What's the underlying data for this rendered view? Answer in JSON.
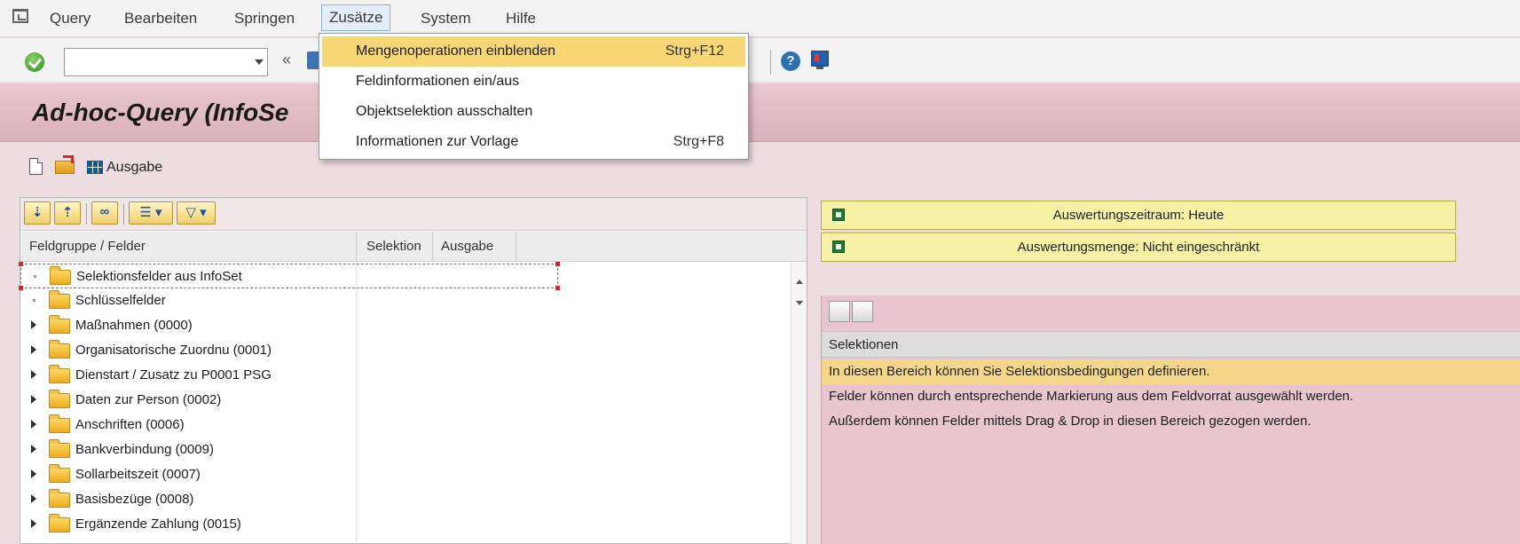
{
  "menubar": {
    "items": [
      {
        "label": "Query",
        "underline_first": true
      },
      {
        "label": "Bearbeiten",
        "underline_first": true
      },
      {
        "label": "Springen",
        "underline_first": true
      },
      {
        "label": "Zusätze",
        "underline_first": true,
        "active": true
      },
      {
        "label": "System",
        "underline_first": true
      },
      {
        "label": "Hilfe",
        "underline_first": true
      }
    ]
  },
  "dropdown": {
    "items": [
      {
        "label": "Mengenoperationen einblenden",
        "shortcut": "Strg+F12",
        "highlighted": true
      },
      {
        "label": "Feldinformationen ein/aus",
        "shortcut": ""
      },
      {
        "label": "Objektselektion ausschalten",
        "shortcut": ""
      },
      {
        "label": "Informationen zur Vorlage",
        "shortcut": "Strg+F8"
      }
    ]
  },
  "toolbar": {
    "command_value": ""
  },
  "page": {
    "title": "Ad-hoc-Query (InfoSe"
  },
  "apptoolbar": {
    "ausgabe_label": "Ausgabe"
  },
  "tree": {
    "columns": [
      "Feldgruppe / Felder",
      "Selektion",
      "Ausgabe"
    ],
    "rows": [
      {
        "label": "Selektionsfelder aus InfoSet",
        "expandable": false,
        "focused": true
      },
      {
        "label": "Schlüsselfelder",
        "expandable": false
      },
      {
        "label": "Maßnahmen (0000)",
        "expandable": true
      },
      {
        "label": "Organisatorische Zuordnu (0001)",
        "expandable": true
      },
      {
        "label": "Dienstart / Zusatz zu P0001 PSG",
        "expandable": true
      },
      {
        "label": "Daten zur Person (0002)",
        "expandable": true
      },
      {
        "label": "Anschriften (0006)",
        "expandable": true
      },
      {
        "label": "Bankverbindung (0009)",
        "expandable": true
      },
      {
        "label": "Sollarbeitszeit (0007)",
        "expandable": true
      },
      {
        "label": "Basisbezüge (0008)",
        "expandable": true
      },
      {
        "label": "Ergänzende Zahlung (0015)",
        "expandable": true
      }
    ]
  },
  "right": {
    "buttons": [
      "Auswertungszeitraum: Heute",
      "Auswertungsmenge: Nicht eingeschränkt"
    ],
    "selection": {
      "header": "Selektionen",
      "lines": [
        "In diesen Bereich können Sie Selektionsbedingungen definieren.",
        "Felder können durch entsprechende Markierung aus dem Feldvorrat ausgewählt werden.",
        "Außerdem können Felder mittels Drag & Drop in diesen Bereich gezogen werden."
      ]
    }
  },
  "colors": {
    "accent_yellow": "#f7d774",
    "title_band": "#dbb2bc",
    "folder": "#efad1c"
  }
}
